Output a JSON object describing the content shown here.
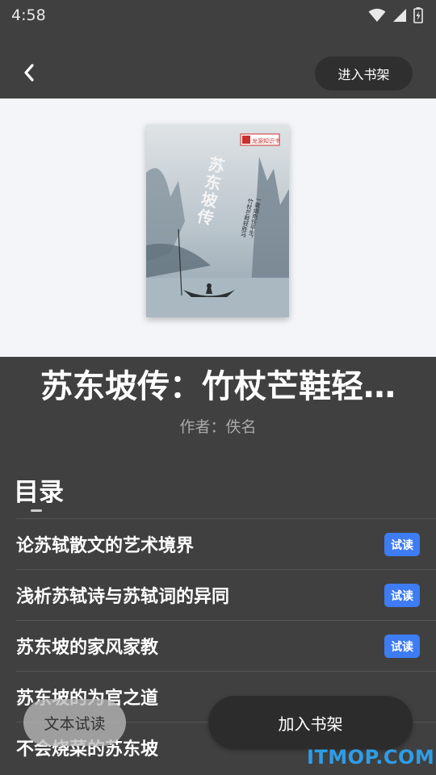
{
  "status": {
    "time": "4:58"
  },
  "header": {
    "shelf_button": "进入书架"
  },
  "cover": {
    "badge": "龙源知识书",
    "title_vertical": "苏东坡传",
    "subtitle_line1": "一蓑烟雨任平生，",
    "subtitle_line2": "竹杖芒鞋轻胜马"
  },
  "book": {
    "title": "苏东坡传：竹杖芒鞋轻…",
    "author": "作者：佚名"
  },
  "toc": {
    "heading": "目录",
    "items": [
      {
        "label": "论苏轼散文的艺术境界",
        "badge": "试读"
      },
      {
        "label": "浅析苏轼诗与苏轼词的异同",
        "badge": "试读"
      },
      {
        "label": "苏东坡的家风家教",
        "badge": "试读"
      },
      {
        "label": "苏东坡的为官之道",
        "badge": ""
      },
      {
        "label": "不会烧菜的苏东坡",
        "badge": ""
      }
    ]
  },
  "actions": {
    "text_trial": "文本试读",
    "add_to_shelf": "加入书架"
  },
  "watermark": "ITMOP.COM",
  "colors": {
    "background": "#404040",
    "badge_blue": "#3d7cf2",
    "watermark": "#2e9de6"
  }
}
